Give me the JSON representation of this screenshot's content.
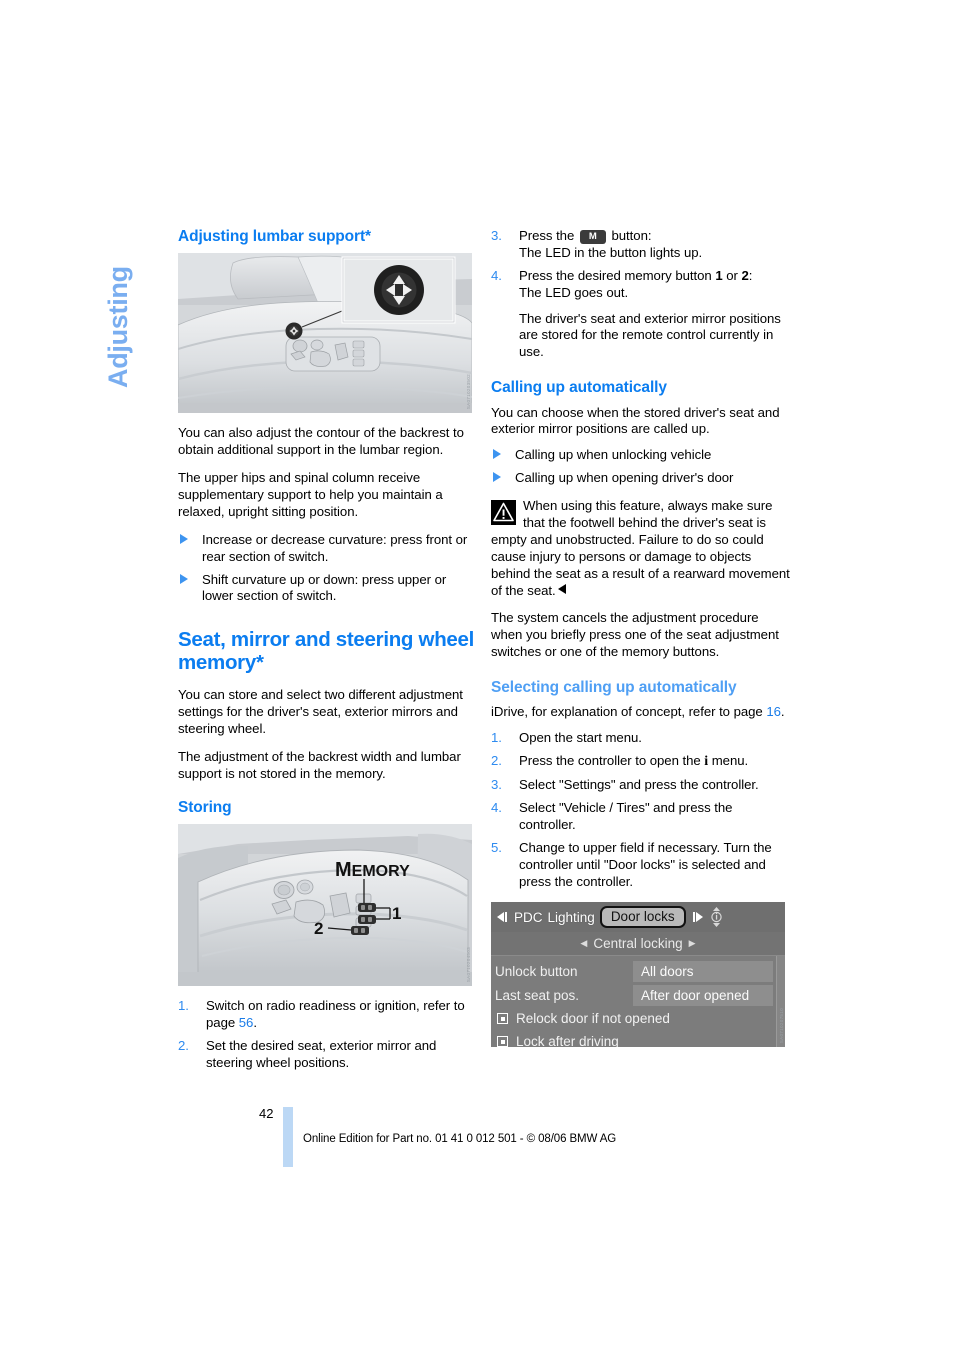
{
  "chapter_tab": "Adjusting",
  "left_column": {
    "heading_lumbar": "Adjusting lumbar support*",
    "figure_lumbar": {
      "alt": "Driver seat side panel with lumbar support switch, inset showing four-way rocker switch",
      "code": "SA0710203502"
    },
    "para1": "You can also adjust the contour of the backrest to obtain additional support in the lumbar region.",
    "para2": "The upper hips and spinal column receive supplementary support to help you maintain a relaxed, upright sitting position.",
    "bullets": [
      "Increase or decrease curvature: press front or rear section of switch.",
      "Shift curvature up or down: press upper or lower section of switch."
    ],
    "heading_memory": "Seat, mirror and steering wheel memory*",
    "para3": "You can store and select two different adjustment settings for the driver's seat, exterior mirrors and steering wheel.",
    "para4": "The adjustment of the backrest width and lumbar support is not stored in the memory.",
    "heading_storing": "Storing",
    "figure_memory": {
      "alt": "Driver seat side panel with MEMORY buttons labelled 1 and 2",
      "label_memory": "MEMORY",
      "callout_1": "1",
      "callout_2": "2",
      "code": "SA0710204503"
    },
    "steps": [
      {
        "num": "1.",
        "text_before": "Switch on radio readiness or ignition, refer to page ",
        "link": "56",
        "text_after": "."
      },
      {
        "num": "2.",
        "text_before": "Set the desired seat, exterior mirror and steering wheel positions.",
        "link": "",
        "text_after": ""
      }
    ]
  },
  "right_column": {
    "steps_top": [
      {
        "num": "3.",
        "line1_a": "Press the ",
        "button_label": "M",
        "line1_b": " button:",
        "line2": "The LED in the button lights up."
      },
      {
        "num": "4.",
        "line1_a": "Press the desired memory button ",
        "bold1": "1",
        "line1_mid": " or ",
        "bold2": "2",
        "line1_b": ":",
        "line2": "The LED goes out.",
        "sub_para": "The driver's seat and exterior mirror positions are stored for the remote control currently in use."
      }
    ],
    "heading_calling": "Calling up automatically",
    "para_calling": "You can choose when the stored driver's seat and exterior mirror positions are called up.",
    "bullets_calling": [
      "Calling up when unlocking vehicle",
      "Calling up when opening driver's door"
    ],
    "warning": "When using this feature, always make sure that the footwell behind the driver's seat is empty and unobstructed. Failure to do so could cause injury to persons or damage to objects behind the seat as a result of a rearward movement of the seat.",
    "para_cancel": "The system cancels the adjustment procedure when you briefly press one of the seat adjustment switches or one of the memory buttons.",
    "heading_selecting": "Selecting calling up automatically",
    "para_idrive_a": "iDrive, for explanation of concept, refer to page ",
    "para_idrive_link": "16",
    "para_idrive_b": ".",
    "steps_bottom": [
      {
        "num": "1.",
        "text": "Open the start menu."
      },
      {
        "num": "2.",
        "text_a": "Press the controller to open the ",
        "icon": "i",
        "text_b": " menu."
      },
      {
        "num": "3.",
        "text": "Select \"Settings\" and press the controller."
      },
      {
        "num": "4.",
        "text": "Select \"Vehicle / Tires\" and press the controller."
      },
      {
        "num": "5.",
        "text": "Change to upper field if necessary. Turn the controller until \"Door locks\" is selected and press the controller."
      }
    ],
    "idrive": {
      "code": "SA0710207510",
      "tabs": [
        "PDC",
        "Lighting",
        "Door locks"
      ],
      "selected_tab": "Door locks",
      "submenu": "Central locking",
      "rows": [
        {
          "label": "Unlock button",
          "value": "All doors"
        },
        {
          "label": "Last seat pos.",
          "value": "After door opened"
        }
      ],
      "checkboxes": [
        {
          "label": "Relock door if not opened",
          "checked": false
        },
        {
          "label": "Lock after driving",
          "checked": false
        }
      ]
    }
  },
  "footer": {
    "page_number": "42",
    "text": "Online Edition for Part no. 01 41 0 012 501 - © 08/06 BMW AG"
  },
  "colors": {
    "heading_blue": "#0b7df0",
    "light_blue": "#4f9ff4",
    "tab_blue": "#7aaef0",
    "bar_blue": "#bcd8f5"
  }
}
